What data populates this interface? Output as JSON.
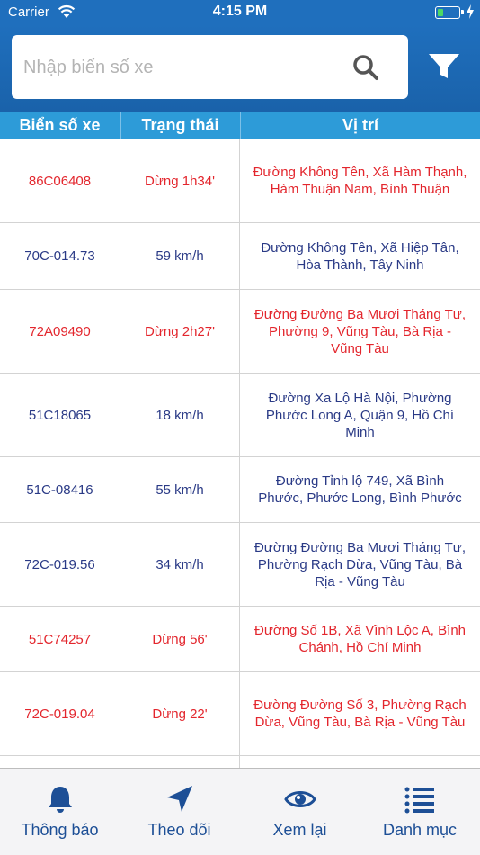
{
  "status_bar": {
    "carrier": "Carrier",
    "time": "4:15 PM",
    "battery_level": 0.25
  },
  "search": {
    "placeholder": "Nhập biển số xe",
    "value": ""
  },
  "table": {
    "headers": [
      "Biển số xe",
      "Trạng thái",
      "Vị trí"
    ],
    "rows": [
      {
        "plate": "86C06408",
        "status": "Dừng 1h34'",
        "location": "Đường Không Tên, Xã Hàm Thạnh, Hàm Thuận Nam, Bình Thuận"
      },
      {
        "plate": "70C-014.73",
        "status": "59 km/h",
        "location": "Đường Không Tên, Xã Hiệp Tân, Hòa Thành, Tây Ninh"
      },
      {
        "plate": "72A09490",
        "status": "Dừng 2h27'",
        "location": "Đường Đường Ba Mươi Tháng Tư, Phường 9, Vũng Tàu, Bà Rịa - Vũng Tàu"
      },
      {
        "plate": "51C18065",
        "status": "18 km/h",
        "location": "Đường Xa Lộ Hà Nội, Phường Phước Long A, Quận 9, Hồ Chí Minh"
      },
      {
        "plate": "51C-08416",
        "status": "55 km/h",
        "location": "Đường Tỉnh lộ 749, Xã Bình Phước, Phước Long, Bình Phước"
      },
      {
        "plate": "72C-019.56",
        "status": "34 km/h",
        "location": "Đường Đường Ba Mươi Tháng Tư, Phường Rạch Dừa, Vũng Tàu, Bà Rịa - Vũng Tàu"
      },
      {
        "plate": "51C74257",
        "status": "Dừng 56'",
        "location": "Đường Số 1B, Xã Vĩnh Lộc A, Bình Chánh, Hồ Chí Minh"
      },
      {
        "plate": "72C-019.04",
        "status": "Dừng 22'",
        "location": "Đường Đường Số 3, Phường Rạch Dừa, Vũng Tàu, Bà Rịa - Vũng Tàu"
      }
    ]
  },
  "tabs": [
    {
      "label": "Thông báo",
      "icon": "bell-icon"
    },
    {
      "label": "Theo dõi",
      "icon": "navigation-arrow-icon"
    },
    {
      "label": "Xem lại",
      "icon": "eye-icon"
    },
    {
      "label": "Danh mục",
      "icon": "list-icon"
    }
  ],
  "colors": {
    "header_blue": "#1f6fbd",
    "table_header": "#2d9bd8",
    "stopped_red": "#e3262d",
    "moving_navy": "#2a3a86",
    "tab_blue": "#1d4f96"
  }
}
